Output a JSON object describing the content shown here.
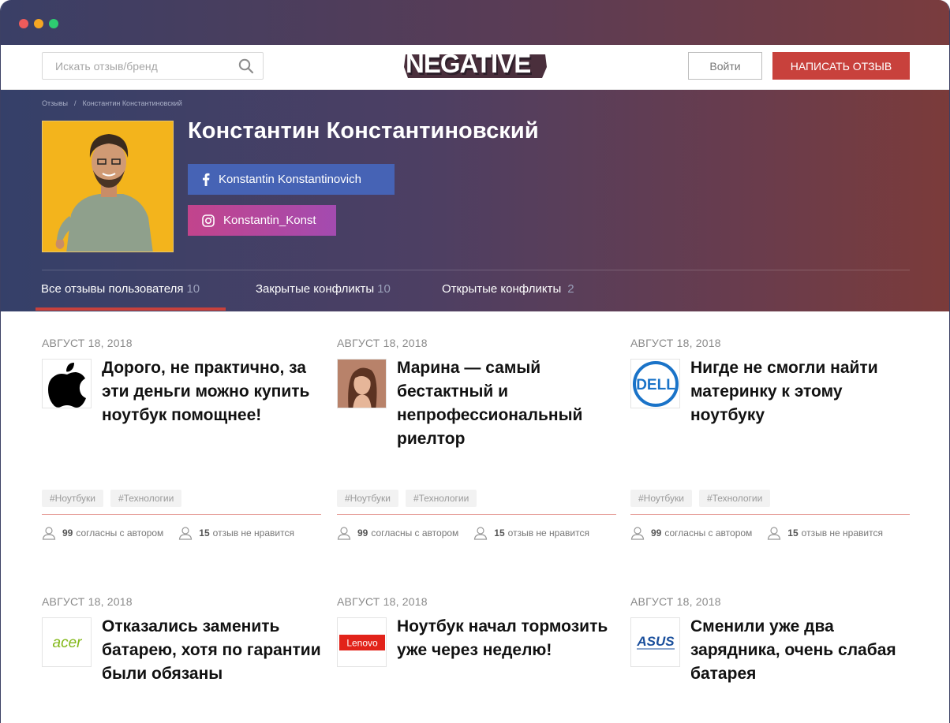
{
  "header": {
    "search_placeholder": "Искать отзыв/бренд",
    "logo_text": "NEGATIVE",
    "login_label": "Войти",
    "write_review_label": "НАПИСАТЬ ОТЗЫВ"
  },
  "breadcrumb": {
    "root": "Отзывы",
    "separator": "/",
    "current": "Константин Константиновский"
  },
  "profile": {
    "name": "Константин Константиновский",
    "facebook": "Konstantin Konstantinovich",
    "instagram": "Konstantin_Konst"
  },
  "tabs": [
    {
      "label": "Все отзывы пользователя",
      "count": "10"
    },
    {
      "label": "Закрытые конфликты",
      "count": "10"
    },
    {
      "label": "Открытые конфликты",
      "count": "2"
    }
  ],
  "reviews": [
    {
      "date": "АВГУСТ 18, 2018",
      "brand": "apple-logo",
      "title": "Дорого, не практично, за эти деньги можно купить ноутбук помощнее!",
      "tags": [
        "#Ноутбуки",
        "#Технологии"
      ],
      "agree_count": "99",
      "agree_text": "согласны с автором",
      "dislike_count": "15",
      "dislike_text": "отзыв не нравится"
    },
    {
      "date": "АВГУСТ 18, 2018",
      "brand": "person-photo",
      "title": "Марина — самый бестактный и непрофессиональный риелтор",
      "tags": [
        "#Ноутбуки",
        "#Технологии"
      ],
      "agree_count": "99",
      "agree_text": "согласны с автором",
      "dislike_count": "15",
      "dislike_text": "отзыв не нравится"
    },
    {
      "date": "АВГУСТ 18, 2018",
      "brand": "dell-logo",
      "logo_text": "DELL",
      "title": "Нигде не смогли найти материнку к этому ноутбуку",
      "tags": [
        "#Ноутбуки",
        "#Технологии"
      ],
      "agree_count": "99",
      "agree_text": "согласны с автором",
      "dislike_count": "15",
      "dislike_text": "отзыв не нравится"
    },
    {
      "date": "АВГУСТ 18, 2018",
      "brand": "acer-logo",
      "logo_text": "acer",
      "title": "Отказались заменить батарею, хотя по гарантии были обязаны"
    },
    {
      "date": "АВГУСТ 18, 2018",
      "brand": "lenovo-logo",
      "logo_text": "Lenovo",
      "title": "Ноутбук начал тормозить уже через неделю!"
    },
    {
      "date": "АВГУСТ 18, 2018",
      "brand": "asus-logo",
      "logo_text": "ASUS",
      "title": "Сменили уже два зарядника, очень слабая батарея"
    }
  ],
  "colors": {
    "accent": "#c8413c",
    "facebook": "#4663b5",
    "instagram": "#b04aa0"
  }
}
